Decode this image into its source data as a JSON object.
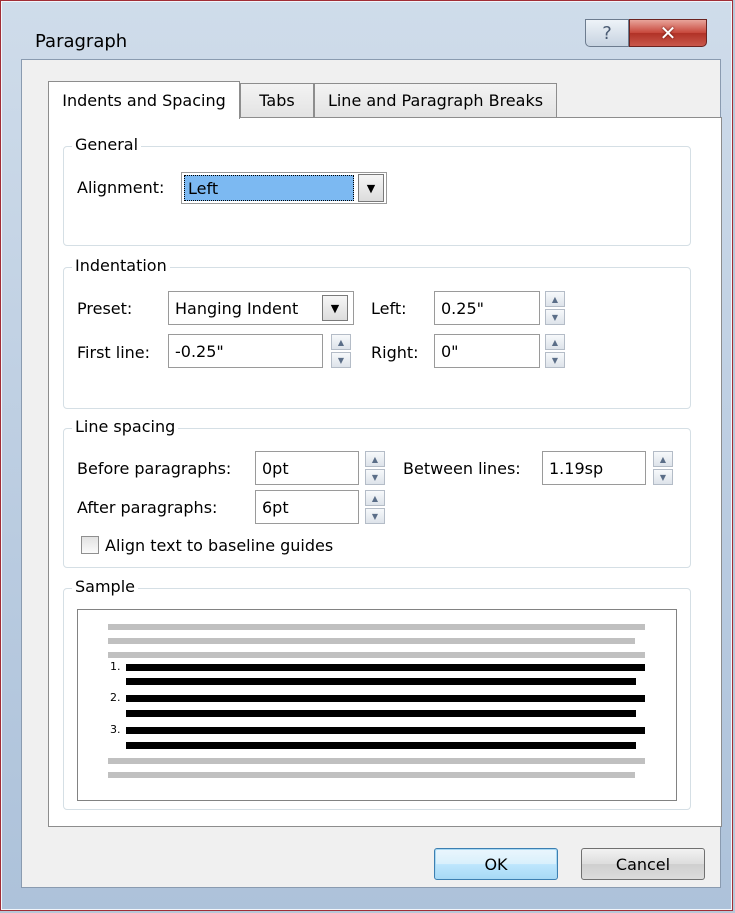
{
  "window": {
    "title": "Paragraph",
    "help_glyph": "?",
    "close_glyph": "✕"
  },
  "tabs": [
    {
      "label": "Indents and Spacing",
      "active": true
    },
    {
      "label": "Tabs",
      "active": false
    },
    {
      "label": "Line and Paragraph Breaks",
      "active": false
    }
  ],
  "general": {
    "legend": "General",
    "alignment_label": "Alignment:",
    "alignment_value": "Left"
  },
  "indentation": {
    "legend": "Indentation",
    "preset_label": "Preset:",
    "preset_value": "Hanging Indent",
    "left_label": "Left:",
    "left_value": "0.25\"",
    "first_line_label": "First line:",
    "first_line_value": "-0.25\"",
    "right_label": "Right:",
    "right_value": "0\""
  },
  "line_spacing": {
    "legend": "Line spacing",
    "before_label": "Before paragraphs:",
    "before_value": "0pt",
    "between_label": "Between lines:",
    "between_value": "1.19sp",
    "after_label": "After paragraphs:",
    "after_value": "6pt",
    "baseline_label": "Align text to baseline guides",
    "baseline_checked": false
  },
  "sample": {
    "legend": "Sample",
    "numbers": [
      "1.",
      "2.",
      "3."
    ]
  },
  "buttons": {
    "ok": "OK",
    "cancel": "Cancel"
  },
  "colors": {
    "close_red": "#c7463a",
    "title_bar": "#cfdcea",
    "selection": "#7cb9f2"
  }
}
